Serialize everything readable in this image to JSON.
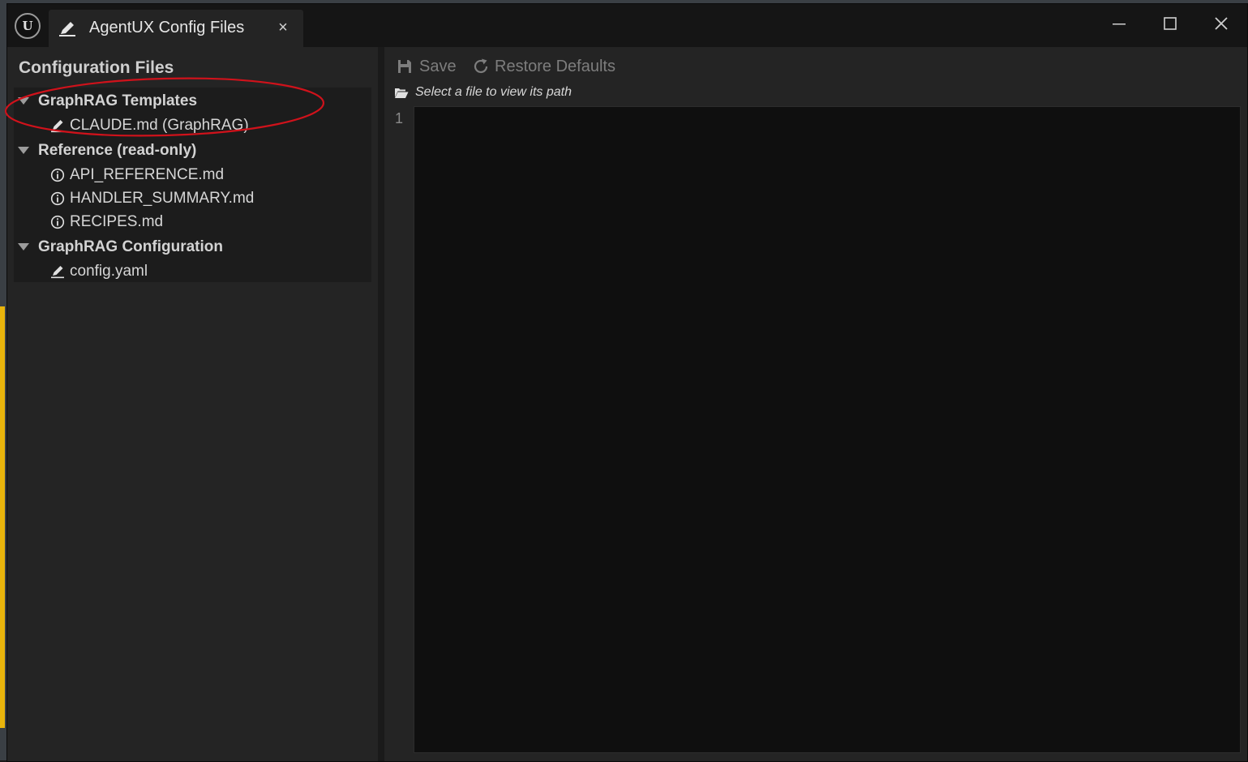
{
  "window": {
    "tab_title": "AgentUX Config Files",
    "tab_close_glyph": "×",
    "logo_text": "U",
    "icons": {
      "logo": "unreal-logo-icon",
      "tab": "pencil-icon",
      "minimize": "minimize-icon",
      "maximize": "maximize-icon",
      "close": "close-icon"
    }
  },
  "left_panel": {
    "title": "Configuration Files",
    "groups": [
      {
        "label": "GraphRAG Templates",
        "items": [
          {
            "label": "CLAUDE.md (GraphRAG)",
            "icon": "pencil-icon"
          }
        ]
      },
      {
        "label": "Reference (read-only)",
        "items": [
          {
            "label": "API_REFERENCE.md",
            "icon": "info-icon"
          },
          {
            "label": "HANDLER_SUMMARY.md",
            "icon": "info-icon"
          },
          {
            "label": "RECIPES.md",
            "icon": "info-icon"
          }
        ]
      },
      {
        "label": "GraphRAG Configuration",
        "items": [
          {
            "label": "config.yaml",
            "icon": "pencil-icon"
          }
        ]
      }
    ]
  },
  "toolbar": {
    "save_label": "Save",
    "restore_label": "Restore Defaults",
    "save_icon": "floppy-disk-icon",
    "restore_icon": "refresh-icon"
  },
  "path_bar": {
    "icon": "folder-open-icon",
    "text": "Select a file to view its path"
  },
  "editor": {
    "line_numbers": [
      "1"
    ],
    "content": ""
  },
  "annotation": {
    "shape": "ellipse",
    "color": "#d0121b"
  },
  "colors": {
    "window_bg": "#151515",
    "panel_bg": "#242424",
    "editor_bg": "#0f0f0f",
    "disabled_text": "#7d7d7d"
  }
}
